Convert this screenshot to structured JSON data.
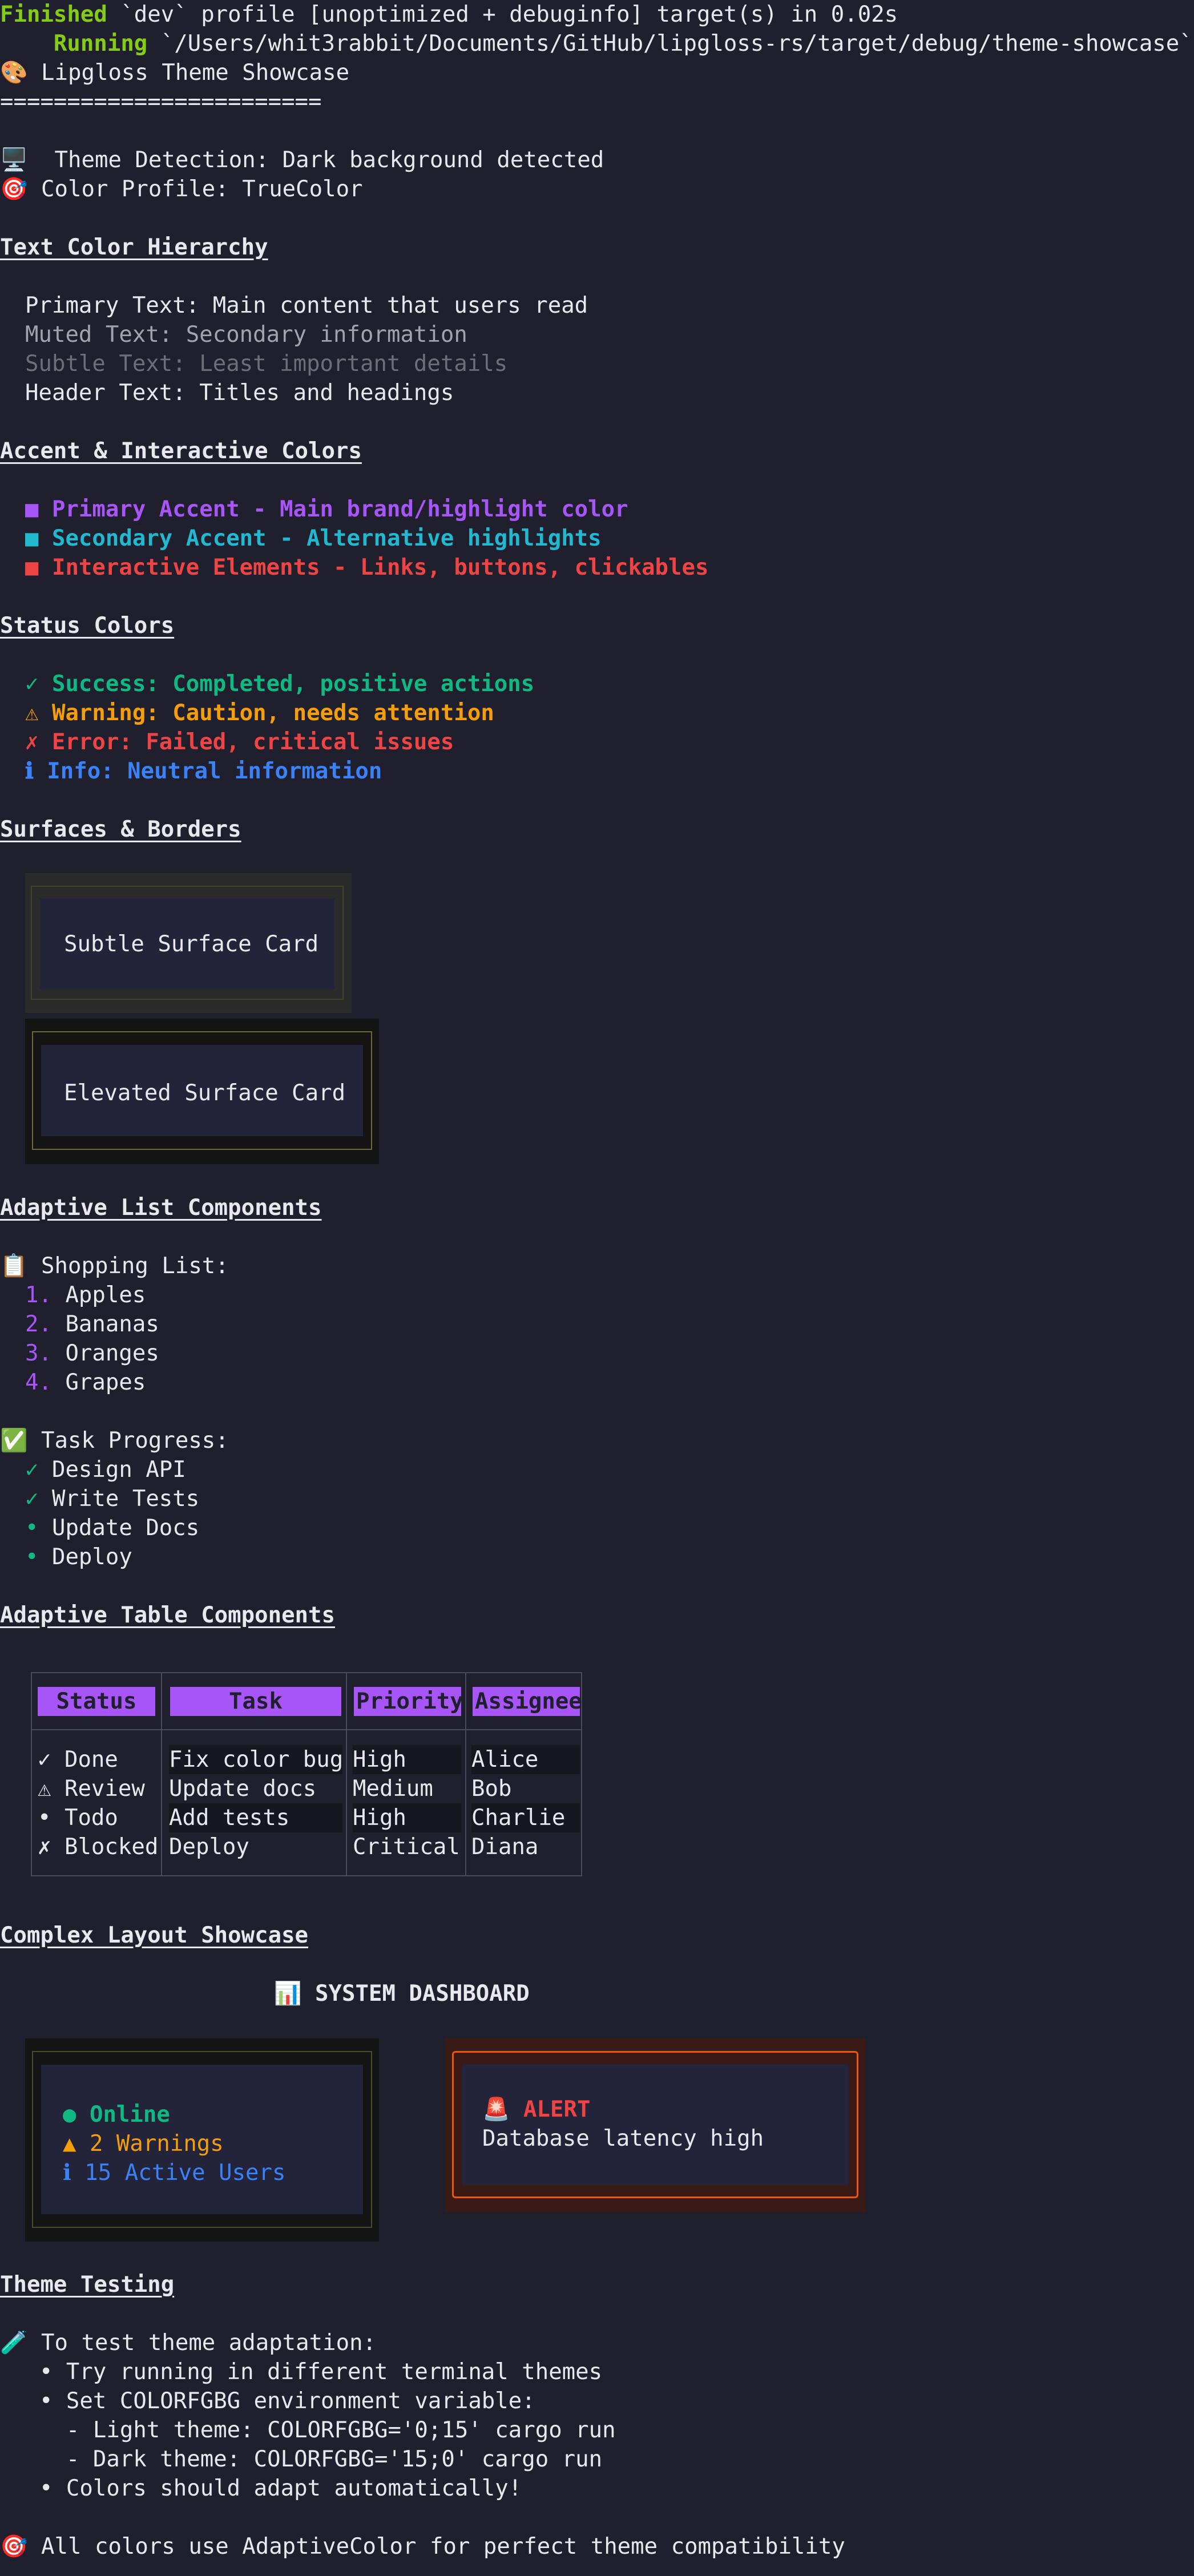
{
  "terminal": {
    "finished_label": "Finished",
    "finished_text": " `dev` profile [unoptimized + debuginfo] target(s) in 0.02s",
    "running_label": "Running",
    "running_text": " `/Users/whit3rabbit/Documents/GitHub/lipgloss-rs/target/debug/theme-showcase`"
  },
  "title": {
    "icon": "🎨",
    "text": " Lipgloss Theme Showcase",
    "rule": "========================"
  },
  "detection": {
    "theme_icon": "🖥️",
    "theme_text": "  Theme Detection: Dark background detected",
    "profile_icon": "🎯",
    "profile_text": " Color Profile: TrueColor"
  },
  "text_hierarchy": {
    "heading": "Text Color Hierarchy",
    "primary": "Primary Text: Main content that users read",
    "muted": "Muted Text: Secondary information",
    "subtle": "Subtle Text: Least important details",
    "header": "Header Text: Titles and headings"
  },
  "accents": {
    "heading": "Accent & Interactive Colors",
    "primary": "■ Primary Accent - Main brand/highlight color",
    "secondary": "■ Secondary Accent - Alternative highlights",
    "interactive": "■ Interactive Elements - Links, buttons, clickables"
  },
  "status": {
    "heading": "Status Colors",
    "success": "✓ Success: Completed, positive actions",
    "warning": "⚠ Warning: Caution, needs attention",
    "error": "✗ Error: Failed, critical issues",
    "info": "ℹ Info: Neutral information"
  },
  "surfaces": {
    "heading": "Surfaces & Borders",
    "subtle_card": "Subtle Surface Card",
    "elevated_card": "Elevated Surface Card"
  },
  "lists": {
    "heading": "Adaptive List Components",
    "shopping_icon": "📋",
    "shopping_title": " Shopping List:",
    "shopping_items": [
      {
        "num": "1.",
        "text": " Apples"
      },
      {
        "num": "2.",
        "text": " Bananas"
      },
      {
        "num": "3.",
        "text": " Oranges"
      },
      {
        "num": "4.",
        "text": " Grapes"
      }
    ],
    "task_icon": "✅",
    "task_title": " Task Progress:",
    "task_items": [
      {
        "mark": "✓",
        "text": " Design API"
      },
      {
        "mark": "✓",
        "text": " Write Tests"
      },
      {
        "mark": "•",
        "text": " Update Docs"
      },
      {
        "mark": "•",
        "text": " Deploy"
      }
    ]
  },
  "table": {
    "heading": "Adaptive Table Components",
    "headers": [
      "Status",
      "Task",
      "Priority",
      "Assignee"
    ],
    "rows": [
      [
        "✓ Done",
        "Fix color bug",
        "High",
        "Alice"
      ],
      [
        "⚠ Review",
        "Update docs",
        "Medium",
        "Bob"
      ],
      [
        "• Todo",
        "Add tests",
        "High",
        "Charlie"
      ],
      [
        "✗ Blocked",
        "Deploy",
        "Critical",
        "Diana"
      ]
    ]
  },
  "layout": {
    "heading": "Complex Layout Showcase",
    "dashboard_icon": "📊",
    "dashboard_title": " SYSTEM DASHBOARD",
    "online": "● Online",
    "warnings": "▲ 2 Warnings",
    "users": "ℹ 15 Active Users",
    "alert_icon": "🚨",
    "alert_title": " ALERT",
    "alert_text": "Database latency high"
  },
  "testing": {
    "heading": "Theme Testing",
    "icon": "🧪",
    "intro": " To test theme adaptation:",
    "lines": [
      "  • Try running in different terminal themes",
      "  • Set COLORFGBG environment variable:",
      "    - Light theme: COLORFGBG='0;15' cargo run",
      "    - Dark theme: COLORFGBG='15;0' cargo run",
      "  • Colors should adapt automatically!"
    ],
    "footer_icon": "🎯",
    "footer": " All colors use AdaptiveColor for perfect theme compatibility"
  },
  "colors": {
    "background": "#1f1f2e",
    "accent_primary": "#a855f7",
    "accent_secondary": "#22b8cf",
    "interactive": "#ef4444",
    "success": "#10b981",
    "warning": "#f59e0b",
    "error": "#ef4444",
    "info": "#3b82f6",
    "alert_border": "#ea580c"
  }
}
